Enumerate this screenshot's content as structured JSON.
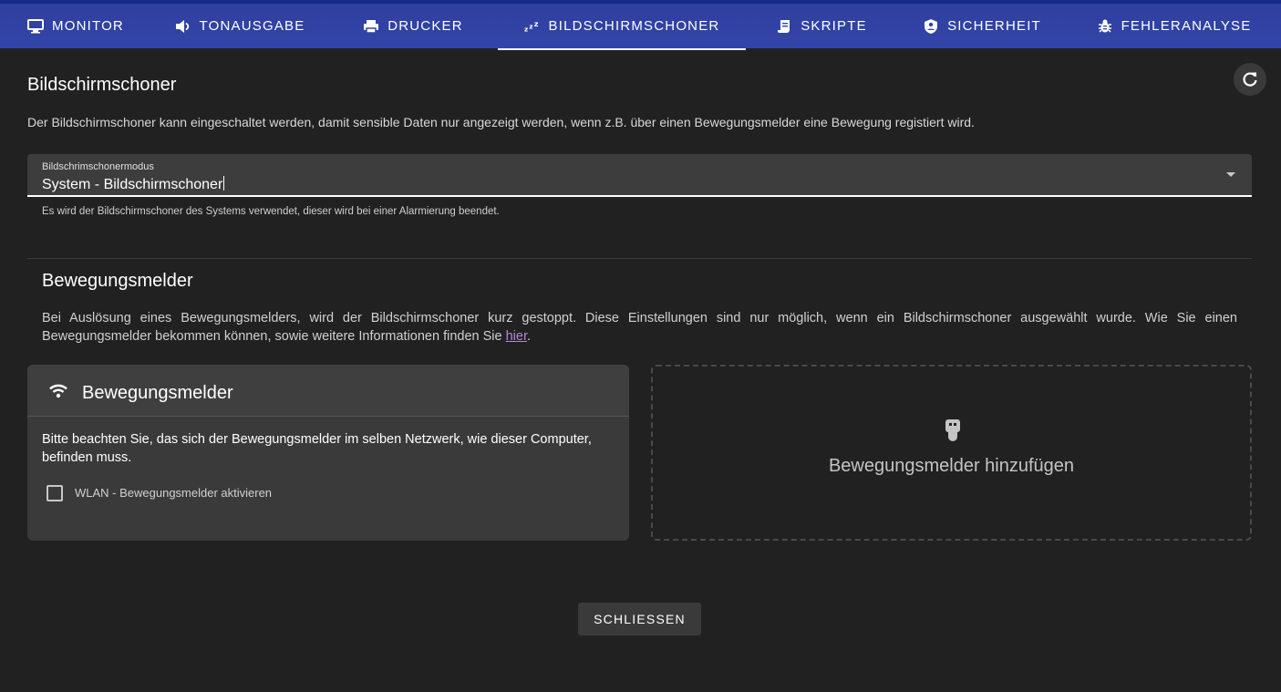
{
  "tabs": [
    {
      "label": "MONITOR",
      "icon": "monitor-icon"
    },
    {
      "label": "TONAUSGABE",
      "icon": "speaker-icon"
    },
    {
      "label": "DRUCKER",
      "icon": "printer-icon"
    },
    {
      "label": "BILDSCHIRMSCHONER",
      "icon": "sleep-zzz-icon",
      "active": true
    },
    {
      "label": "SKRIPTE",
      "icon": "script-icon"
    },
    {
      "label": "SICHERHEIT",
      "icon": "shield-user-icon"
    },
    {
      "label": "FEHLERANALYSE",
      "icon": "bug-icon"
    }
  ],
  "page": {
    "title": "Bildschirmschoner",
    "description": "Der Bildschirmschoner kann eingeschaltet werden, damit sensible Daten nur angezeigt werden, wenn z.B. über einen Bewegungsmelder eine Bewegung registiert wird.",
    "refresh_icon": "refresh-icon"
  },
  "mode_select": {
    "label": "Bildschrimschonermodus",
    "value": "System - Bildschirmschoner",
    "hint": "Es wird der Bildschirmschoner des Systems verwendet, dieser wird bei einer Alarmierung beendet."
  },
  "motion": {
    "title": "Bewegungsmelder",
    "description_before": "Bei Auslösung eines Bewegungsmelders, wird der Bildschirmschoner kurz gestoppt. Diese Einstellungen sind nur möglich, wenn ein Bildschirmschoner ausgewählt wurde. Wie Sie einen Bewegungsmelder bekommen können, sowie weitere Informationen finden Sie ",
    "link_text": "hier",
    "description_after": ".",
    "card": {
      "title": "Bewegungsmelder",
      "icon": "wifi-icon",
      "body": "Bitte beachten Sie, das sich der Bewegungsmelder im selben Netzwerk, wie dieser Computer, befinden muss.",
      "checkbox_label": "WLAN - Bewegungsmelder aktivieren",
      "checkbox_checked": false
    },
    "add": {
      "label": "Bewegungsmelder hinzufügen",
      "icon": "usb-device-icon"
    }
  },
  "footer": {
    "close_label": "SCHLIESSEN"
  },
  "colors": {
    "tabbar": "#3345a8",
    "background": "#212121",
    "link": "#b48ad6"
  }
}
